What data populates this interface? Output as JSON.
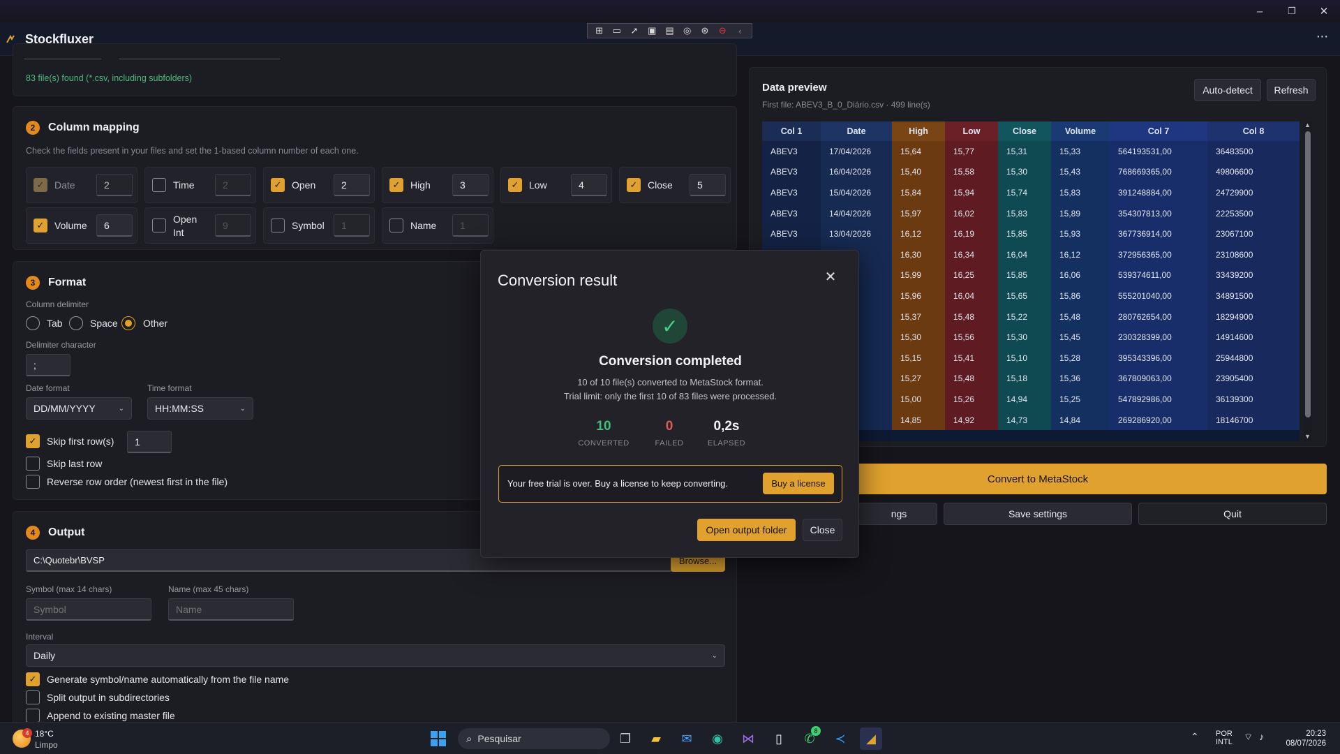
{
  "window": {
    "minimize": "–",
    "maximize": "❐",
    "close": "✕"
  },
  "app": {
    "name": "Stockfluxer",
    "menu": "···"
  },
  "overlay_toolbar": {
    "icons": [
      "select-tool-icon",
      "camera-icon",
      "pointer-icon",
      "frame-icon",
      "screen-icon",
      "gamepad-icon",
      "accessibility-icon",
      "stop-icon",
      "collapse-icon"
    ]
  },
  "files_found": "83 file(s) found (*.csv, including subfolders)",
  "mapping": {
    "step": "2",
    "title": "Column mapping",
    "hint": "Check the fields present in your files and set the 1-based column number of each one.",
    "fields": [
      {
        "label": "Date",
        "value": "2",
        "checked": true,
        "disabled": true
      },
      {
        "label": "Time",
        "value": "2",
        "checked": false
      },
      {
        "label": "Open",
        "value": "2",
        "checked": true
      },
      {
        "label": "High",
        "value": "3",
        "checked": true
      },
      {
        "label": "Low",
        "value": "4",
        "checked": true
      },
      {
        "label": "Close",
        "value": "5",
        "checked": true
      },
      {
        "label": "Volume",
        "value": "6",
        "checked": true
      },
      {
        "label": "Open Int",
        "value": "9",
        "checked": false
      },
      {
        "label": "Symbol",
        "value": "1",
        "checked": false
      },
      {
        "label": "Name",
        "value": "1",
        "checked": false
      }
    ]
  },
  "format": {
    "step": "3",
    "title": "Format",
    "delimiter_label": "Column delimiter",
    "delim_tab": "Tab",
    "delim_space": "Space",
    "delim_other": "Other",
    "delim_char_label": "Delimiter character",
    "delim_char": ";",
    "date_format_label": "Date format",
    "date_format": "DD/MM/YYYY",
    "time_format_label": "Time format",
    "time_format": "HH:MM:SS",
    "skip_first": "Skip first row(s)",
    "skip_first_value": "1",
    "skip_last": "Skip last row",
    "reverse": "Reverse row order (newest first in the file)"
  },
  "output": {
    "step": "4",
    "title": "Output",
    "path": "C:\\Quotebr\\BVSP",
    "browse": "Browse...",
    "symbol_label": "Symbol (max 14 chars)",
    "symbol_placeholder": "Symbol",
    "name_label": "Name (max 45 chars)",
    "name_placeholder": "Name",
    "interval_label": "Interval",
    "interval": "Daily",
    "gen_auto": "Generate symbol/name automatically from the file name",
    "split": "Split output in subdirectories",
    "append": "Append to existing master file"
  },
  "preview": {
    "title": "Data preview",
    "subtitle": "First file: ABEV3_B_0_Diário.csv · 499 line(s)",
    "auto_detect": "Auto-detect",
    "refresh": "Refresh",
    "headers": [
      "Col 1",
      "Date",
      "High",
      "Low",
      "Close",
      "Volume",
      "Col 7",
      "Col 8"
    ],
    "rows": [
      [
        "ABEV3",
        "17/04/2026",
        "15,64",
        "15,77",
        "15,31",
        "15,33",
        "564193531,00",
        "36483500"
      ],
      [
        "ABEV3",
        "16/04/2026",
        "15,40",
        "15,58",
        "15,30",
        "15,43",
        "768669365,00",
        "49806600"
      ],
      [
        "ABEV3",
        "15/04/2026",
        "15,84",
        "15,94",
        "15,74",
        "15,83",
        "391248884,00",
        "24729900"
      ],
      [
        "ABEV3",
        "14/04/2026",
        "15,97",
        "16,02",
        "15,83",
        "15,89",
        "354307813,00",
        "22253500"
      ],
      [
        "ABEV3",
        "13/04/2026",
        "16,12",
        "16,19",
        "15,85",
        "15,93",
        "367736914,00",
        "23067100"
      ],
      [
        "",
        "026",
        "16,30",
        "16,34",
        "16,04",
        "16,12",
        "372956365,00",
        "23108600"
      ],
      [
        "",
        "026",
        "15,99",
        "16,25",
        "15,85",
        "16,06",
        "539374611,00",
        "33439200"
      ],
      [
        "",
        "026",
        "15,96",
        "16,04",
        "15,65",
        "15,86",
        "555201040,00",
        "34891500"
      ],
      [
        "",
        "026",
        "15,37",
        "15,48",
        "15,22",
        "15,48",
        "280762654,00",
        "18294900"
      ],
      [
        "",
        "026",
        "15,30",
        "15,56",
        "15,30",
        "15,45",
        "230328399,00",
        "14914600"
      ],
      [
        "",
        "026",
        "15,15",
        "15,41",
        "15,10",
        "15,28",
        "395343396,00",
        "25944800"
      ],
      [
        "",
        "026",
        "15,27",
        "15,48",
        "15,18",
        "15,36",
        "367809063,00",
        "23905400"
      ],
      [
        "",
        "026",
        "15,00",
        "15,26",
        "14,94",
        "15,25",
        "547892986,00",
        "36139300"
      ],
      [
        "",
        "026",
        "14,85",
        "14,92",
        "14,73",
        "14,84",
        "269286920,00",
        "18146700"
      ]
    ]
  },
  "actions": {
    "convert": "Convert to MetaStock",
    "load_settings_tail": "ngs",
    "save_settings": "Save settings",
    "quit": "Quit"
  },
  "modal": {
    "title": "Conversion result",
    "check": "✓",
    "heading": "Conversion completed",
    "line1": "10 of 10 file(s) converted to MetaStock format.",
    "line2": "Trial limit: only the first 10 of 83 files were processed.",
    "converted_value": "10",
    "converted_label": "CONVERTED",
    "failed_value": "0",
    "failed_label": "FAILED",
    "elapsed_value": "0,2s",
    "elapsed_label": "ELAPSED",
    "trial_msg": "Your free trial is over. Buy a license to keep converting.",
    "buy": "Buy a license",
    "open_folder": "Open output folder",
    "close": "Close"
  },
  "taskbar": {
    "weather_temp": "18°C",
    "weather_desc": "Limpo",
    "weather_badge": "4",
    "search_placeholder": "Pesquisar",
    "whatsapp_badge": "8",
    "lang1": "POR",
    "lang2": "INTL",
    "time": "20:23",
    "date": "08/07/2026"
  },
  "colors": {
    "accent": "#e0a12e",
    "success": "#3fbf7f",
    "danger": "#e05a5a"
  }
}
